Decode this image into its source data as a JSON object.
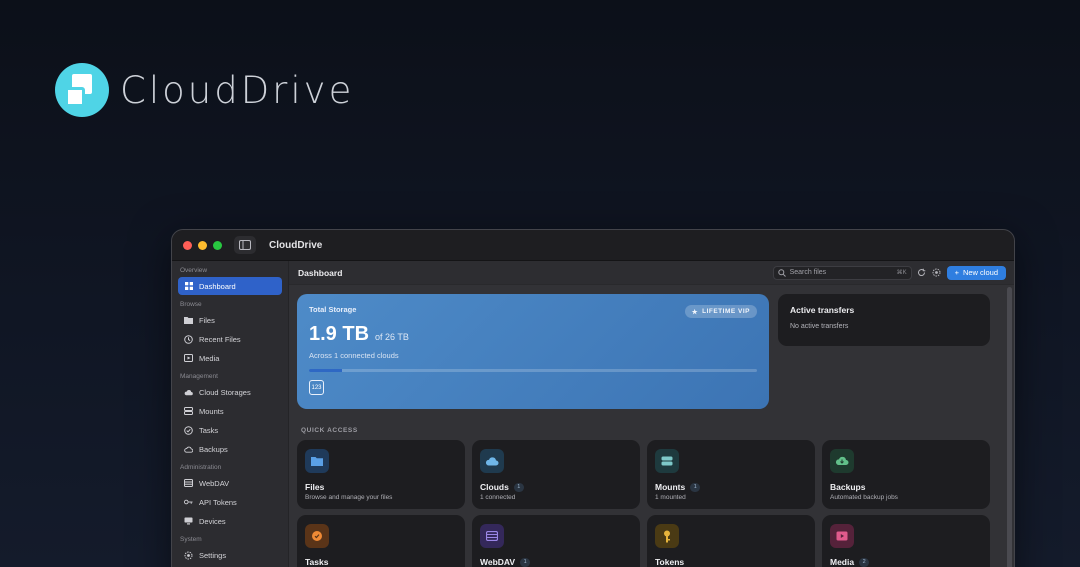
{
  "brand": {
    "name": "CloudDrive"
  },
  "window": {
    "title": "CloudDrive"
  },
  "sidebar": {
    "sections": [
      {
        "label": "Overview",
        "items": [
          {
            "label": "Dashboard",
            "icon": "grid-icon",
            "active": true
          }
        ]
      },
      {
        "label": "Browse",
        "items": [
          {
            "label": "Files",
            "icon": "folder-icon"
          },
          {
            "label": "Recent Files",
            "icon": "clock-icon"
          },
          {
            "label": "Media",
            "icon": "media-icon"
          }
        ]
      },
      {
        "label": "Management",
        "items": [
          {
            "label": "Cloud Storages",
            "icon": "cloud-icon"
          },
          {
            "label": "Mounts",
            "icon": "drive-icon"
          },
          {
            "label": "Tasks",
            "icon": "tasks-icon"
          },
          {
            "label": "Backups",
            "icon": "backup-icon"
          }
        ]
      },
      {
        "label": "Administration",
        "items": [
          {
            "label": "WebDAV",
            "icon": "server-icon"
          },
          {
            "label": "API Tokens",
            "icon": "key-icon"
          },
          {
            "label": "Devices",
            "icon": "monitor-icon"
          }
        ]
      },
      {
        "label": "System",
        "items": [
          {
            "label": "Settings",
            "icon": "gear-icon"
          }
        ]
      }
    ]
  },
  "topbar": {
    "title": "Dashboard",
    "search_placeholder": "Search files",
    "search_shortcut": "⌘K",
    "new_cloud_label": "New cloud"
  },
  "storage": {
    "label": "Total Storage",
    "badge": "LIFETIME VIP",
    "used": "1.9 TB",
    "total": "of 26 TB",
    "subtitle": "Across 1 connected clouds",
    "used_fraction": 0.073,
    "badge_icon_text": "123"
  },
  "transfers": {
    "title": "Active transfers",
    "empty": "No active transfers"
  },
  "quick_access": {
    "label": "QUICK ACCESS",
    "cards": [
      {
        "title": "Files",
        "desc": "Browse and manage your files",
        "count": "",
        "color": "#1f3a5a",
        "icon": "folder-icon"
      },
      {
        "title": "Clouds",
        "desc": "1 connected",
        "count": "1",
        "color": "#1f3a4e",
        "icon": "cloud-icon"
      },
      {
        "title": "Mounts",
        "desc": "1 mounted",
        "count": "1",
        "color": "#1e3a3e",
        "icon": "drive-icon"
      },
      {
        "title": "Backups",
        "desc": "Automated backup jobs",
        "count": "",
        "color": "#1e3a2e",
        "icon": "backup-icon"
      },
      {
        "title": "Tasks",
        "desc": "",
        "count": "",
        "color": "#5a3418",
        "icon": "tasks-icon"
      },
      {
        "title": "WebDAV",
        "desc": "",
        "count": "1",
        "color": "#34285a",
        "icon": "server-icon"
      },
      {
        "title": "Tokens",
        "desc": "",
        "count": "",
        "color": "#4a3a14",
        "icon": "key-icon"
      },
      {
        "title": "Media",
        "desc": "",
        "count": "2",
        "color": "#55223a",
        "icon": "media-icon"
      }
    ]
  },
  "colors": {
    "accent": "#2f62c9",
    "button": "#2f7ee0",
    "card": "#4e8bc8"
  }
}
